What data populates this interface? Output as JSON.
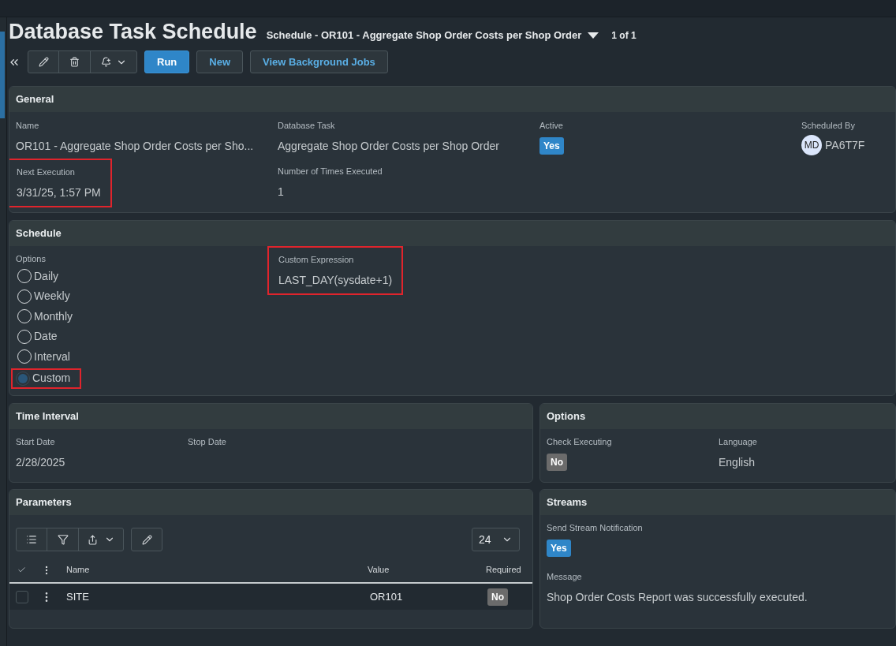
{
  "header": {
    "title": "Database Task Schedule",
    "subtitle": "Schedule - OR101 - Aggregate Shop Order Costs per Shop Order",
    "pager": "1 of 1"
  },
  "toolbar": {
    "buttons": [
      {
        "label": "Run",
        "kind": "primary"
      },
      {
        "label": "New",
        "kind": "secondary"
      },
      {
        "label": "View Background Jobs",
        "kind": "secondary"
      }
    ]
  },
  "general": {
    "title": "General",
    "rows": [
      [
        {
          "label": "Name",
          "value": "OR101 - Aggregate Shop Order Costs per Sho...",
          "kind": "text",
          "highlighted": false
        },
        {
          "label": "Database Task",
          "value": "Aggregate Shop Order Costs per Shop Order",
          "kind": "text",
          "highlighted": false
        },
        {
          "label": "Active",
          "value": "Yes",
          "kind": "badge",
          "on": true,
          "highlighted": false
        },
        {
          "label": "Scheduled By",
          "value": "PA6T7F",
          "initials": "MD",
          "kind": "user",
          "highlighted": false
        }
      ],
      [
        {
          "label": "Next Execution",
          "value": "3/31/25, 1:57 PM",
          "kind": "text",
          "highlighted": true
        },
        {
          "label": "Number of Times Executed",
          "value": "1",
          "kind": "text",
          "highlighted": false
        }
      ]
    ]
  },
  "schedule": {
    "title": "Schedule",
    "options_label": "Options",
    "options": [
      {
        "label": "Daily",
        "selected": false,
        "highlighted": false
      },
      {
        "label": "Weekly",
        "selected": false,
        "highlighted": false
      },
      {
        "label": "Monthly",
        "selected": false,
        "highlighted": false
      },
      {
        "label": "Date",
        "selected": false,
        "highlighted": false
      },
      {
        "label": "Interval",
        "selected": false,
        "highlighted": false
      },
      {
        "label": "Custom",
        "selected": true,
        "highlighted": true
      }
    ],
    "custom_expression": {
      "label": "Custom Expression",
      "value": "LAST_DAY(sysdate+1)",
      "kind": "text",
      "highlighted": true
    }
  },
  "time_interval": {
    "title": "Time Interval",
    "fields": [
      {
        "label": "Start Date",
        "value": "2/28/2025",
        "kind": "text",
        "highlighted": false
      },
      {
        "label": "Stop Date",
        "kind": "text",
        "highlighted": false
      }
    ]
  },
  "options": {
    "title": "Options",
    "fields": [
      {
        "label": "Check Executing",
        "value": "No",
        "kind": "badge",
        "on": false,
        "highlighted": false
      },
      {
        "label": "Language",
        "value": "English",
        "kind": "text",
        "highlighted": false
      }
    ]
  },
  "parameters": {
    "title": "Parameters",
    "page_size": "24",
    "columns": [
      "Name",
      "Value",
      "Required"
    ],
    "rows": [
      {
        "name": "SITE",
        "value": "OR101",
        "required": "No",
        "required_on": false,
        "selected": false
      }
    ]
  },
  "streams": {
    "title": "Streams",
    "fields": [
      {
        "label": "Send Stream Notification",
        "value": "Yes",
        "kind": "badge",
        "on": true,
        "highlighted": false
      },
      {
        "label": "Message",
        "value": "Shop Order Costs Report was successfully executed.",
        "kind": "text",
        "highlighted": false
      }
    ]
  }
}
